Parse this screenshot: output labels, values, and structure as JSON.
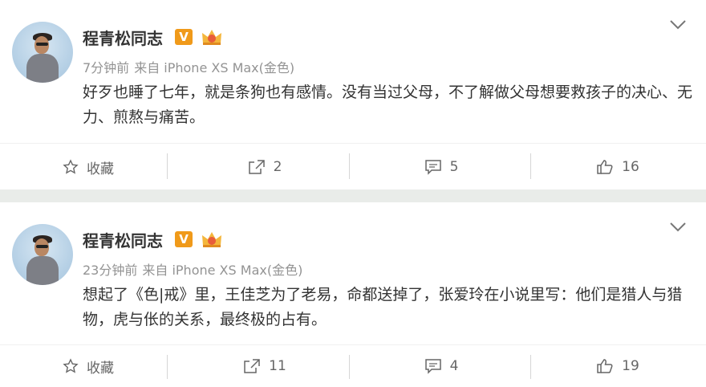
{
  "posts": [
    {
      "author": "程青松同志",
      "verified_mark": "V",
      "time": "7分钟前",
      "source": "来自 iPhone XS Max(金色)",
      "text": "好歹也睡了七年，就是条狗也有感情。没有当过父母，不了解做父母想要救孩子的决心、无力、煎熬与痛苦。",
      "actions": {
        "favorite": "收藏",
        "repost": "2",
        "comment": "5",
        "like": "16"
      }
    },
    {
      "author": "程青松同志",
      "verified_mark": "V",
      "time": "23分钟前",
      "source": "来自 iPhone XS Max(金色)",
      "text": "想起了《色|戒》里，王佳芝为了老易，命都送掉了，张爱玲在小说里写：他们是猎人与猎物，虎与伥的关系，最终极的占有。",
      "actions": {
        "favorite": "收藏",
        "repost": "11",
        "comment": "4",
        "like": "19"
      }
    }
  ],
  "colors": {
    "badge": "#f09a1a",
    "text": "#333333",
    "meta": "#939393",
    "divider": "#e9ece9"
  },
  "icons": [
    "avatar",
    "verified-v-badge",
    "crown-badge-icon",
    "chevron-down-icon",
    "star-icon",
    "share-icon",
    "comment-icon",
    "thumbs-up-icon"
  ]
}
